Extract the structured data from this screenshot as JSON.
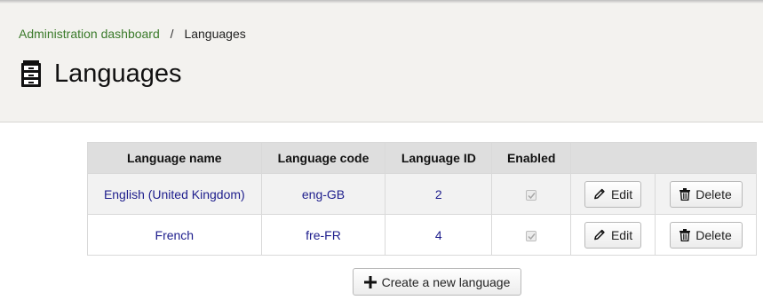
{
  "breadcrumb": {
    "parent": "Administration dashboard",
    "separator": "/",
    "current": "Languages"
  },
  "page": {
    "title": "Languages",
    "title_icon": "cabinet-icon"
  },
  "table": {
    "columns": [
      "Language name",
      "Language code",
      "Language ID",
      "Enabled",
      ""
    ],
    "rows": [
      {
        "name": "English (United Kingdom)",
        "code": "eng-GB",
        "id": "2",
        "enabled": true
      },
      {
        "name": "French",
        "code": "fre-FR",
        "id": "4",
        "enabled": true
      }
    ],
    "edit_label": "Edit",
    "delete_label": "Delete"
  },
  "actions": {
    "create_label": "Create a new language"
  },
  "colors": {
    "header_bg": "#f3f2ef",
    "link_green": "#3a7a2a",
    "cell_text": "#1d1d8c"
  }
}
